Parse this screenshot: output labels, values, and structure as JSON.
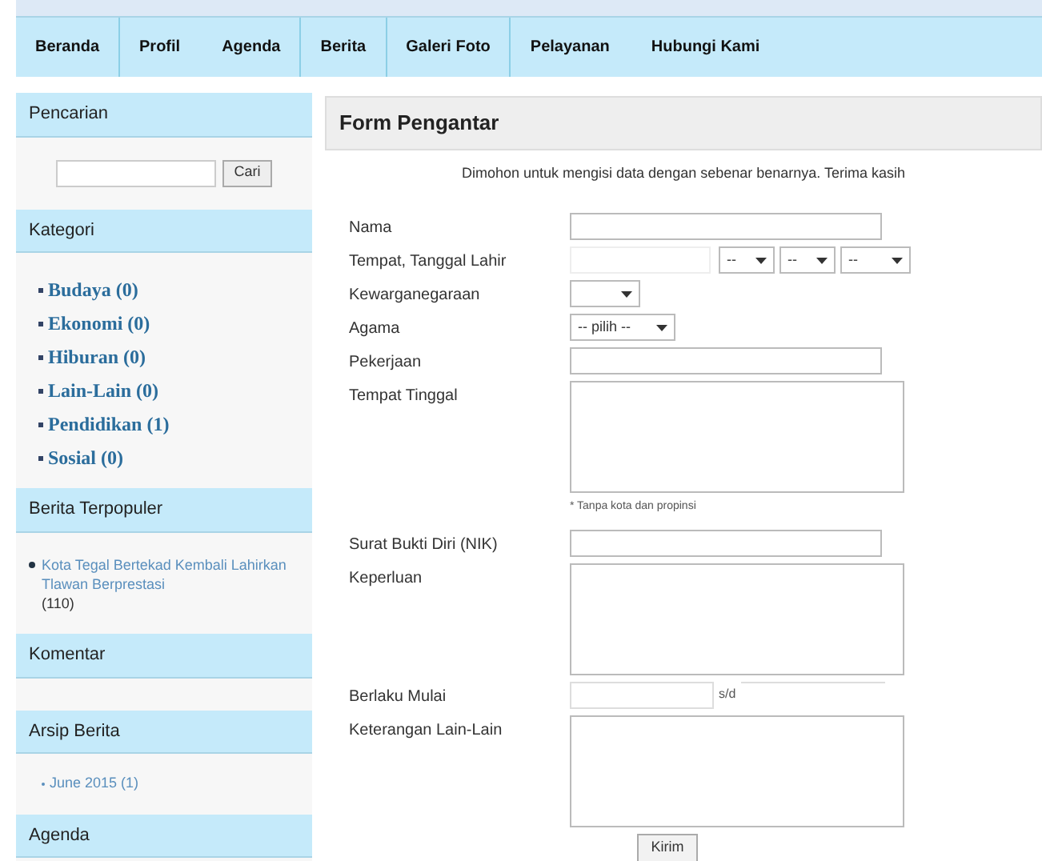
{
  "nav": {
    "groups": [
      [
        "Beranda"
      ],
      [
        "Profil",
        "Agenda"
      ],
      [
        "Berita"
      ],
      [
        "Galeri Foto"
      ],
      [
        "Pelayanan",
        "Hubungi Kami"
      ]
    ]
  },
  "sidebar": {
    "search": {
      "title": "Pencarian",
      "button": "Cari"
    },
    "categories": {
      "title": "Kategori",
      "items": [
        "Budaya (0)",
        "Ekonomi (0)",
        "Hiburan (0)",
        "Lain-Lain (0)",
        "Pendidikan (1)",
        "Sosial (0)"
      ]
    },
    "popular": {
      "title": "Berita Terpopuler",
      "items": [
        {
          "title": "Kota Tegal Bertekad Kembali Lahirkan Tlawan Berprestasi",
          "count": "(110)"
        }
      ]
    },
    "comments": {
      "title": "Komentar"
    },
    "archive": {
      "title": "Arsip Berita",
      "items": [
        "June 2015 (1)"
      ]
    },
    "agenda": {
      "title": "Agenda"
    }
  },
  "form": {
    "title": "Form Pengantar",
    "intro": "Dimohon untuk mengisi data dengan sebenar benarnya. Terima kasih",
    "fields": [
      {
        "kind": "text",
        "label": "Nama"
      },
      {
        "kind": "birth",
        "label": "Tempat, Tanggal Lahir",
        "selects": [
          "--",
          "--",
          "--"
        ]
      },
      {
        "kind": "select",
        "label": "Kewarganegaraan"
      },
      {
        "kind": "select",
        "label": "Agama",
        "value": "-- pilih --"
      },
      {
        "kind": "text",
        "label": "Pekerjaan"
      },
      {
        "kind": "textarea",
        "label": "Tempat Tinggal",
        "note": "* Tanpa kota dan propinsi"
      },
      {
        "kind": "text",
        "label": "Surat Bukti Diri (NIK)"
      },
      {
        "kind": "textarea",
        "label": "Keperluan"
      },
      {
        "kind": "range",
        "label": "Berlaku Mulai",
        "separator": "s/d"
      },
      {
        "kind": "textarea",
        "label": "Keterangan Lain-Lain"
      }
    ],
    "submit": "Kirim"
  }
}
